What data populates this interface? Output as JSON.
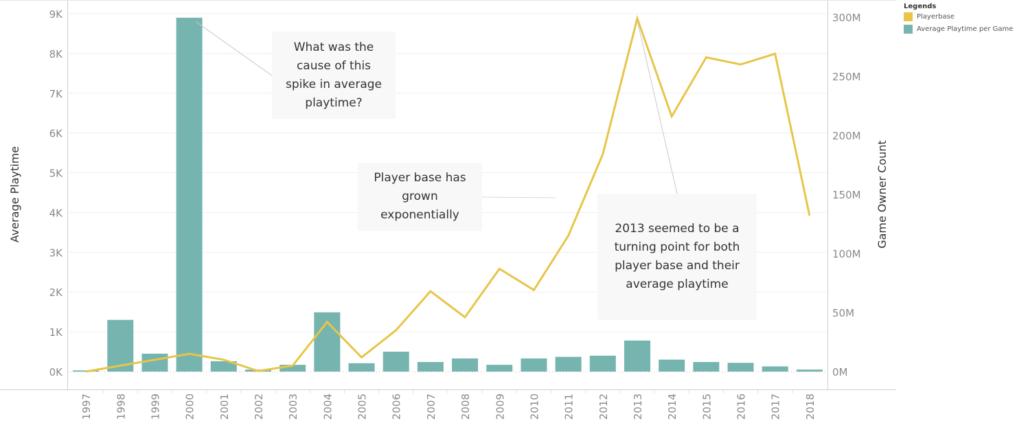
{
  "chart_data": {
    "type": "bar+line",
    "categories": [
      "1997",
      "1998",
      "1999",
      "2000",
      "2001",
      "2002",
      "2003",
      "2004",
      "2005",
      "2006",
      "2007",
      "2008",
      "2009",
      "2010",
      "2011",
      "2012",
      "2013",
      "2014",
      "2015",
      "2016",
      "2017",
      "2018"
    ],
    "series": [
      {
        "name": "Average Playtime per Game",
        "type": "bar",
        "axis": "left",
        "color": "#76b5af",
        "values": [
          30,
          1300,
          450,
          8900,
          260,
          50,
          170,
          1490,
          210,
          500,
          240,
          330,
          170,
          330,
          370,
          400,
          780,
          300,
          240,
          220,
          130,
          50
        ]
      },
      {
        "name": "Playerbase",
        "type": "line",
        "axis": "right",
        "color": "#e8c547",
        "values": [
          0,
          5,
          10,
          15,
          10,
          0.5,
          5,
          42,
          12,
          35,
          68,
          46,
          87,
          69,
          115,
          184,
          299,
          216,
          266,
          260,
          269,
          132
        ]
      }
    ],
    "y_left": {
      "label": "Average Playtime",
      "range": [
        0,
        9000
      ],
      "ticks": [
        0,
        1000,
        2000,
        3000,
        4000,
        5000,
        6000,
        7000,
        8000,
        9000
      ],
      "tick_labels": [
        "0K",
        "1K",
        "2K",
        "3K",
        "4K",
        "5K",
        "6K",
        "7K",
        "8K",
        "9K"
      ]
    },
    "y_right": {
      "label": "Game Owner Count",
      "unit": "millions",
      "range": [
        0,
        300
      ],
      "ticks": [
        0,
        50,
        100,
        150,
        200,
        250,
        300
      ],
      "tick_labels": [
        "0M",
        "50M",
        "100M",
        "150M",
        "200M",
        "250M",
        "300M"
      ]
    },
    "grid": true,
    "legend": {
      "title": "Legends",
      "position": "top-right",
      "items": [
        {
          "label": "Playerbase",
          "color": "#e8c547"
        },
        {
          "label": "Average Playtime per Game",
          "color": "#76b5af"
        }
      ]
    },
    "annotations": [
      {
        "text": "What was the cause of this spike in average playtime?",
        "target": "2000 bar"
      },
      {
        "text": "Player base has grown exponentially",
        "target": "playerbase trend"
      },
      {
        "text": "2013 seemed to be a turning point for both player base and their average playtime",
        "target": "2013 playerbase peak"
      }
    ]
  }
}
